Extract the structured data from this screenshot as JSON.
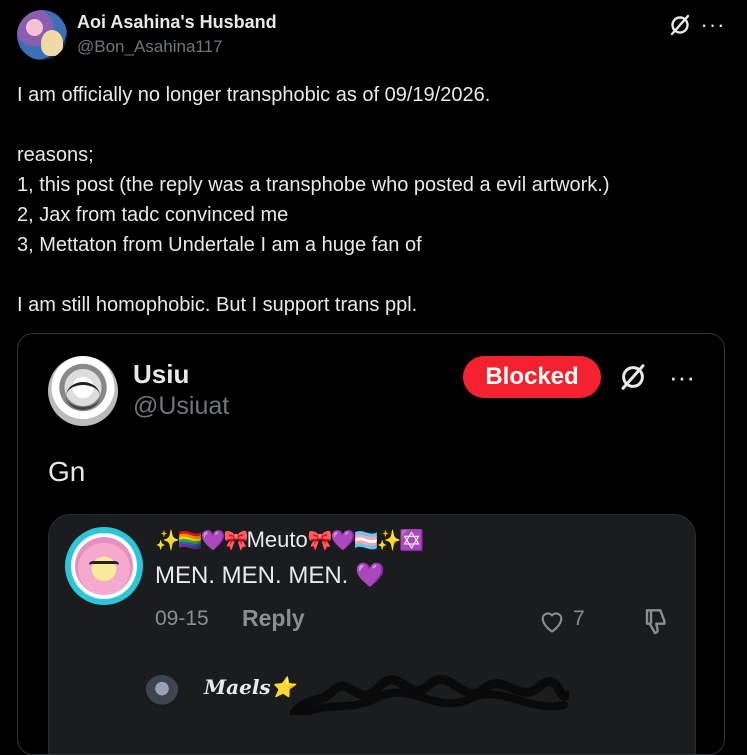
{
  "author": {
    "display_name": "Aoi Asahina's Husband",
    "handle": "@Bon_Asahina117"
  },
  "header_actions": {
    "grok_icon": "grok-slash-icon",
    "more_icon": "more-dots-icon",
    "more_label": "···"
  },
  "tweet": {
    "text": "I am officially no longer transphobic as of 09/19/2026.\n\nreasons;\n1, this post (the reply was a transphobe who posted a evil artwork.)\n2, Jax from tadc convinced me\n3, Mettaton from Undertale I am a huge fan of\n\nI am still homophobic. But I support trans ppl."
  },
  "quote": {
    "display_name": "Usiu",
    "handle": "@Usiuat",
    "blocked_label": "Blocked",
    "more_label": "···",
    "text": "Gn",
    "embedded_reply": {
      "name_prefix": "✨🏳️‍🌈💜🎀",
      "name": "Meuto",
      "name_suffix": "🎀💜🏳️‍⚧️✨✡️",
      "text": "MEN. MEN. MEN. ",
      "heart": "💜",
      "date": "09-15",
      "reply_label": "Reply",
      "like_count": "7",
      "sub_reply_name": "Maels⭐"
    }
  },
  "colors": {
    "background": "#000000",
    "blocked": "#f4212e",
    "muted": "#71767b",
    "card": "#1b1c1e",
    "avatar_ring": "#2dc6d8"
  }
}
